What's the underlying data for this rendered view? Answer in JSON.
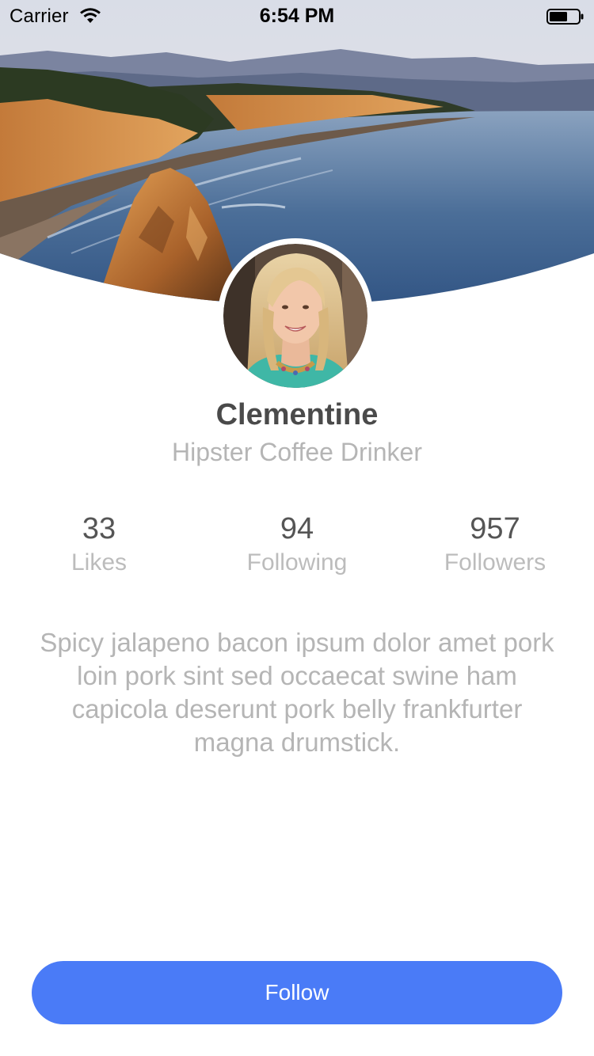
{
  "status_bar": {
    "carrier": "Carrier",
    "time": "6:54 PM"
  },
  "profile": {
    "name": "Clementine",
    "subtitle": "Hipster Coffee Drinker",
    "bio": "Spicy jalapeno bacon ipsum dolor amet pork loin pork sint sed occaecat swine ham capicola deserunt pork belly frankfurter magna drumstick."
  },
  "stats": [
    {
      "value": "33",
      "label": "Likes"
    },
    {
      "value": "94",
      "label": "Following"
    },
    {
      "value": "957",
      "label": "Followers"
    }
  ],
  "actions": {
    "follow_label": "Follow"
  },
  "colors": {
    "accent": "#4a7bf7",
    "name_text": "#4a4a4a",
    "muted_text": "#b5b5b5"
  },
  "icons": {
    "wifi": "wifi-icon",
    "battery": "battery-icon"
  }
}
